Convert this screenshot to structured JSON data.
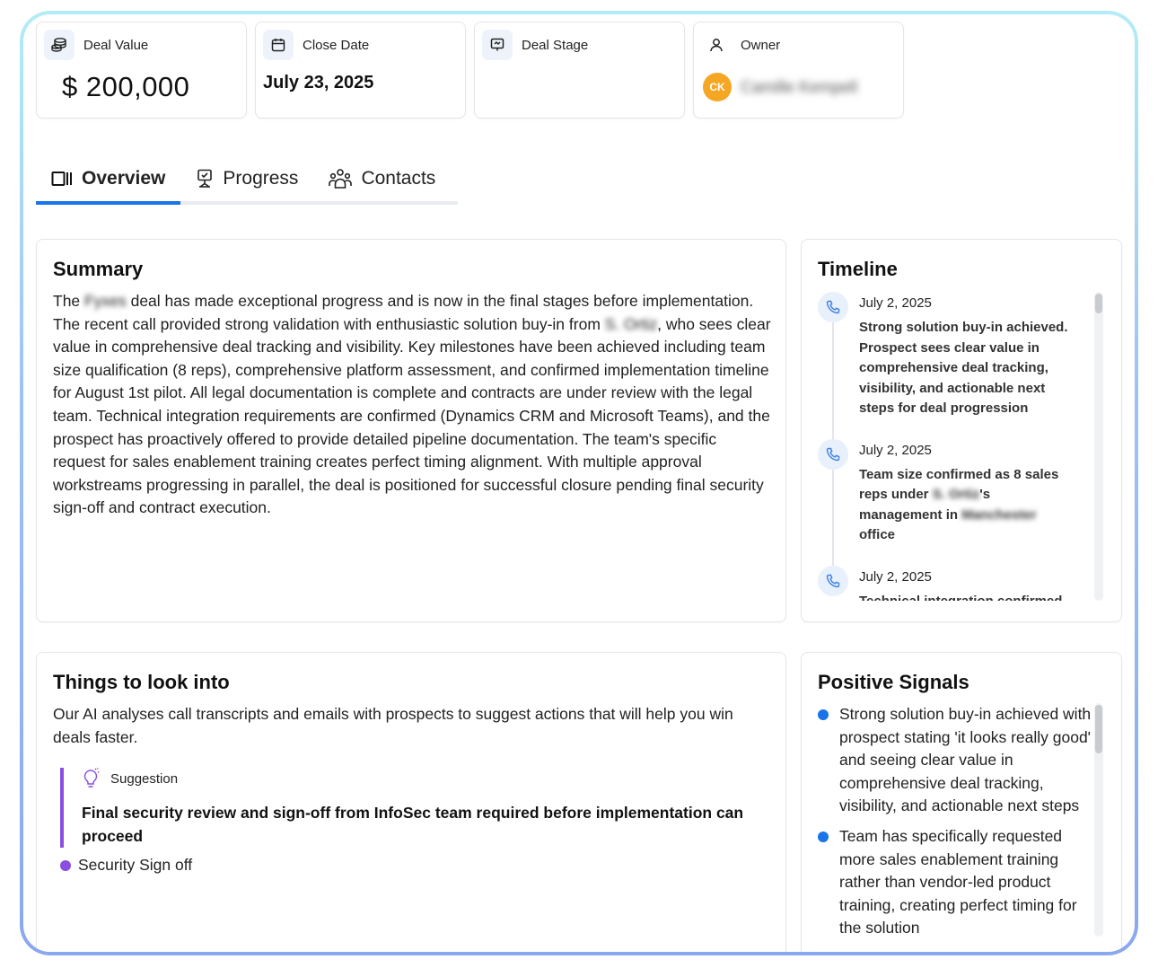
{
  "stats": {
    "deal_value": {
      "label": "Deal Value",
      "value": "$ 200,000",
      "icon": "coins-icon"
    },
    "close_date": {
      "label": "Close Date",
      "value": "July 23, 2025",
      "icon": "calendar-icon"
    },
    "deal_stage": {
      "label": "Deal Stage",
      "value": "",
      "icon": "presentation-icon"
    },
    "owner": {
      "label": "Owner",
      "initials": "CK",
      "name": "Camille Kempell",
      "icon": "user-icon"
    }
  },
  "tabs": [
    {
      "label": "Overview",
      "active": true,
      "icon": "columns-icon"
    },
    {
      "label": "Progress",
      "active": false,
      "icon": "monitor-icon"
    },
    {
      "label": "Contacts",
      "active": false,
      "icon": "users-icon"
    }
  ],
  "summary": {
    "title": "Summary",
    "text_1": "The ",
    "redacted_1": "Fyxes",
    "text_2": " deal has made exceptional progress and is now in the final stages before implementation. The recent call provided strong validation with enthusiastic solution buy-in from ",
    "redacted_2": "S. Ortiz",
    "text_3": ", who sees clear value in comprehensive deal tracking and visibility. Key milestones have been achieved including team size qualification (8 reps), comprehensive platform assessment, and confirmed implementation timeline for August 1st pilot. All legal documentation is complete and contracts are under review with the legal team. Technical integration requirements are confirmed (Dynamics CRM and Microsoft Teams), and the prospect has proactively offered to provide detailed pipeline documentation. The team's specific request for sales enablement training creates perfect timing alignment. With multiple approval workstreams progressing in parallel, the deal is positioned for successful closure pending final security sign-off and contract execution."
  },
  "timeline": {
    "title": "Timeline",
    "items": [
      {
        "date": "July 2, 2025",
        "text": "Strong solution buy-in achieved. Prospect sees clear value in comprehensive deal tracking, visibility, and actionable next steps for deal progression",
        "icon": "phone-icon"
      },
      {
        "date": "July 2, 2025",
        "text_a": "Team size confirmed as 8 sales reps under ",
        "redacted_a": "S. Ortiz",
        "text_b": "'s management in ",
        "redacted_b": "Manchester",
        "text_c": " office",
        "icon": "phone-icon"
      },
      {
        "date": "July 2, 2025",
        "text": "Technical integration confirmed",
        "icon": "phone-icon"
      }
    ]
  },
  "things": {
    "title": "Things to look into",
    "description": "Our AI analyses call transcripts and emails with prospects to suggest actions that will help you win deals faster.",
    "suggestion_label": "Suggestion",
    "suggestion_text": "Final security review and sign-off from InfoSec team required before implementation can proceed",
    "tag": "Security Sign off",
    "tag_color": "#8a4fe0"
  },
  "signals": {
    "title": "Positive Signals",
    "items": [
      "Strong solution buy-in achieved with prospect stating 'it looks really good' and seeing clear value in comprehensive deal tracking, visibility, and actionable next steps",
      "Team has specifically requested more sales enablement training rather than vendor-led product training, creating perfect timing for the solution"
    ]
  },
  "colors": {
    "accent": "#1a73e8",
    "suggestion": "#8a4fe0",
    "avatar": "#f5a623"
  }
}
